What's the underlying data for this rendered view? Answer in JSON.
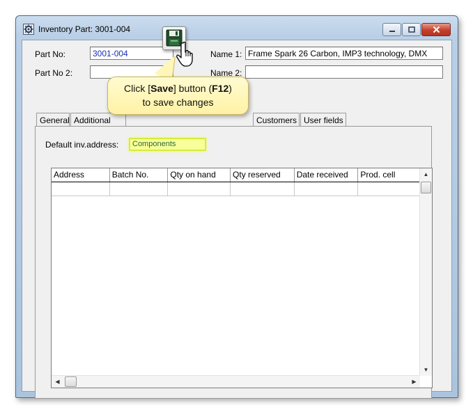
{
  "window": {
    "title": "Inventory Part: 3001-004",
    "icons": {
      "app": "gear-app-icon",
      "minimize": "minimize-icon",
      "maximize": "maximize-icon",
      "close": "close-icon"
    }
  },
  "header": {
    "part_no_label": "Part No:",
    "part_no_value": "3001-004",
    "part_no2_label": "Part No 2:",
    "part_no2_value": "",
    "name1_label": "Name 1:",
    "name1_value": "Frame Spark 26 Carbon, IMP3 technology, DMX",
    "name2_label": "Name 2:",
    "name2_value": ""
  },
  "tabs": [
    {
      "label": "General"
    },
    {
      "label": "Additional"
    },
    {
      "label": "Customers"
    },
    {
      "label": "User fields"
    }
  ],
  "panel": {
    "default_address_label": "Default inv.address:",
    "default_address_value": "Components"
  },
  "grid": {
    "columns": [
      "Address",
      "Batch No.",
      "Qty on hand",
      "Qty reserved",
      "Date received",
      "Prod. cell"
    ]
  },
  "callout": {
    "text_1": "Click [",
    "bold_1": "Save",
    "text_2": "] button (",
    "bold_2": "F12",
    "text_3": ")",
    "line_2": "to save changes"
  },
  "toolbar": {
    "save_icon": "floppy-disk-save-icon",
    "cursor": "hand-pointer-icon"
  },
  "colors": {
    "highlight_field": "#f8ff9a",
    "callout_bg": "#fff6b8",
    "part_no_text": "#1a2db0"
  }
}
